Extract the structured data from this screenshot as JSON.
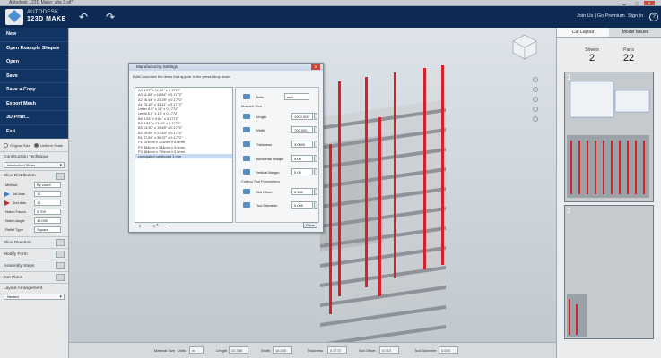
{
  "window": {
    "title": "Autodesk 123D Make: ulta 3.stl*"
  },
  "header": {
    "brand_line1": "AUTODESK",
    "brand_line2": "123D MAKE",
    "join_link": "Join Us | Go Premium",
    "signin_link": "Sign In",
    "help": "?"
  },
  "sidebar": {
    "menu": [
      "New",
      "Open Example Shapes",
      "Open",
      "Save",
      "Save a Copy",
      "Export Mesh",
      "3D Print...",
      "Exit"
    ],
    "size_options": {
      "original": "Original Size",
      "uniform": "Uniform Scale"
    },
    "construction": {
      "title": "Construction Technique",
      "value": "Interlocked Slices"
    },
    "slice_distribution": {
      "title": "Slice Distribution",
      "method_label": "Method",
      "method_value": "By count",
      "axis1_label": "1st Axis",
      "axis1_value": "12",
      "axis2_label": "2nd Axis",
      "axis2_value": "12",
      "notch_factor_label": "Notch Factor",
      "notch_factor_value": "0.700",
      "notch_angle_label": "Notch Angle",
      "notch_angle_value": "45.000",
      "relief_label": "Relief Type",
      "relief_value": "Square"
    },
    "buttons": [
      "Slice Direction",
      "Modify Form",
      "Assembly Steps",
      "Get Plans"
    ],
    "layout": {
      "title": "Layout Arrangement",
      "value": "Nested"
    }
  },
  "dialog": {
    "title": "Manufacturing Settings",
    "description": "Edit/Customize the items that appear in the preset drop down",
    "presets": [
      "A4 8.27\" x 11.69\" x 0.1772\"",
      "A3 11.69\" x 16.54\" x 0.1772\"",
      "A2 16.54\" x 23.39\" x 0.1772\"",
      "A1 23.39\" x 33.11\" x 0.1772\"",
      "Letter 8.5\" x 11\" x 0.1772\"",
      "Legal 8.5\" x 14\" x 0.1772\"",
      "B5 6.93\" x 9.84\" x 0.1772\"",
      "B4 9.84\" x 13.90\" x 0.1772\"",
      "B3 13.90\" x 19.69\" x 0.1772\"",
      "B2 19.69\" x 27.83\" x 0.1772\"",
      "B1 27.83\" x 39.37\" x 0.1772\"",
      "P1 101mm x 101mm x 4.5mm",
      "P2 384mm x 384mm x 4.5mm",
      "P3 384mm x 790mm x 4.5mm",
      "corrugated cardboard 3 mm"
    ],
    "units_label": "Units",
    "units_value": "mm",
    "material_size_label": "Material Size",
    "length_label": "Length",
    "length_value": "1000.000",
    "width_label": "Width",
    "width_value": "700.000",
    "thickness_label": "Thickness",
    "thickness_value": "3.0000",
    "hmargin_label": "Horizontal Margin",
    "hmargin_value": "5.00",
    "vmargin_label": "Vertical Margin",
    "vmargin_value": "5.00",
    "cutting_label": "Cutting Tool Parameters",
    "slot_label": "Slot Offset",
    "slot_value": "0.100",
    "tool_label": "Tool Diameter",
    "tool_value": "0.000",
    "foot_add": "+",
    "foot_dup": "+²",
    "foot_remove": "−",
    "done": "Done"
  },
  "bottombar": {
    "material_label": "Material Size",
    "units_label": "Units",
    "units_value": "in",
    "length_label": "Length",
    "length_value": "22.386",
    "width_label": "Width",
    "width_value": "16.540",
    "thickness_label": "Thickness",
    "thickness_value": "0.1772",
    "slot_label": "Slot Offset",
    "slot_value": "0.010",
    "tool_label": "Tool Diameter",
    "tool_value": "0.000"
  },
  "right_panel": {
    "tabs": [
      "Cut Layout",
      "Model Issues"
    ],
    "sheets_label": "Sheets",
    "sheets_value": "2",
    "parts_label": "Parts",
    "parts_value": "22",
    "sheet1": "1",
    "sheet2": "2"
  },
  "colors": {
    "topbar": "#0d2a52",
    "menu": "#133564",
    "slice_red": "#d8202a"
  }
}
